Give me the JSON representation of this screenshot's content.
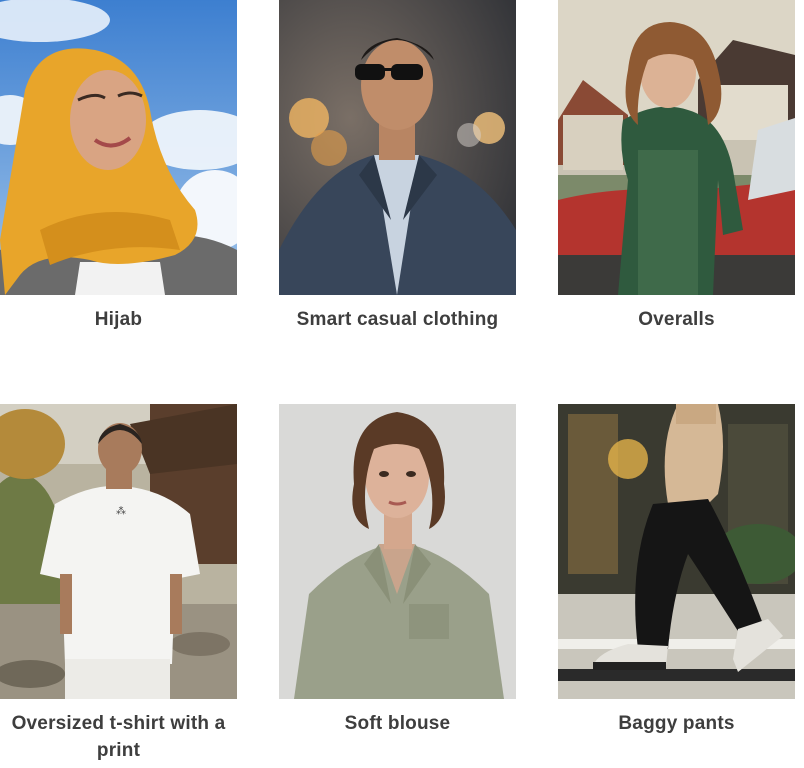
{
  "items": [
    {
      "label": "Hijab",
      "icon": "person-hijab-photo"
    },
    {
      "label": "Smart casual clothing",
      "icon": "person-suit-photo"
    },
    {
      "label": "Overalls",
      "icon": "person-overalls-photo"
    },
    {
      "label": "Oversized t-shirt with a print",
      "icon": "person-tshirt-photo"
    },
    {
      "label": "Soft blouse",
      "icon": "person-blouse-photo"
    },
    {
      "label": "Baggy pants",
      "icon": "person-baggy-pants-photo"
    }
  ]
}
